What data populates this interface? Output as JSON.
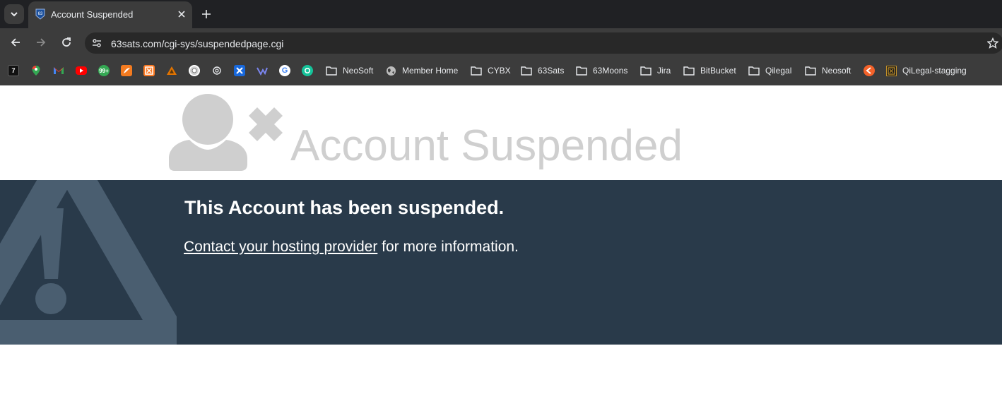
{
  "browser": {
    "tab": {
      "title": "Account Suspended",
      "favicon": "shield-63-icon"
    },
    "omnibox": {
      "url": "63sats.com/cgi-sys/suspendedpage.cgi"
    },
    "bookmarks": {
      "app_icons": [
        "zed-app",
        "google-maps",
        "gmail",
        "youtube",
        "counter-99",
        "sketch-orange",
        "xampp",
        "workbench",
        "chrome-circle",
        "openai",
        "jira-blue",
        "wise",
        "google",
        "grammarly"
      ],
      "items": [
        {
          "label": "NeoSoft",
          "icon": "folder-icon"
        },
        {
          "label": "Member Home",
          "icon": "globe-icon"
        },
        {
          "label": "CYBX",
          "icon": "folder-icon"
        },
        {
          "label": "63Sats",
          "icon": "folder-icon"
        },
        {
          "label": "63Moons",
          "icon": "folder-icon"
        },
        {
          "label": "Jira",
          "icon": "folder-icon"
        },
        {
          "label": "BitBucket",
          "icon": "folder-icon"
        },
        {
          "label": "Qilegal",
          "icon": "folder-icon"
        },
        {
          "label": "Neosoft",
          "icon": "folder-icon"
        },
        {
          "label": "QiLegal-stagging",
          "icon": "qilegal-icon"
        }
      ]
    }
  },
  "page": {
    "title": "Account Suspended",
    "heading": "This Account has been suspended.",
    "contact_link": "Contact your hosting provider",
    "contact_suffix": " for more information.",
    "colors": {
      "band": "#293a4a",
      "title": "#cfcfcf",
      "icon": "#cfcfcf"
    }
  }
}
